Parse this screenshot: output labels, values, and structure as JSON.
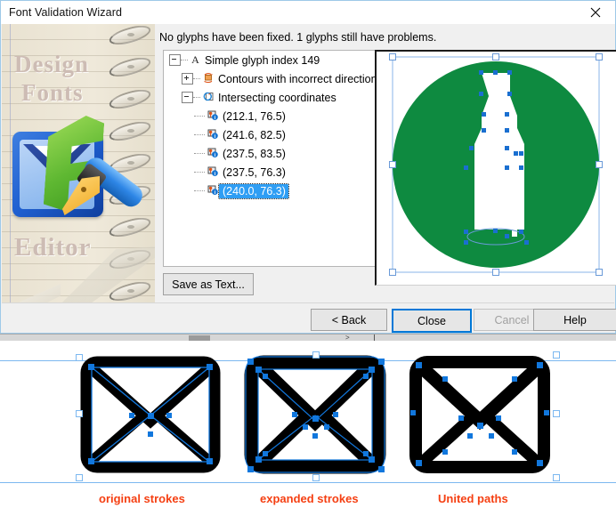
{
  "window": {
    "title": "Font Validation Wizard",
    "close_icon": "close-icon"
  },
  "status": {
    "message": "No glyphs have been fixed. 1 glyphs still have problems."
  },
  "banner": {
    "word_top": "Design",
    "word_mid": "Fonts",
    "word_bottom": "Editor"
  },
  "tree": {
    "root": {
      "label": "Simple glyph index 149",
      "icon": "glyph-a-icon",
      "expander": "minus"
    },
    "nodes": [
      {
        "label": "Contours with incorrect direction",
        "icon": "contour-direction-icon",
        "expander": "plus"
      },
      {
        "label": "Intersecting coordinates",
        "icon": "intersecting-coordinates-icon",
        "expander": "minus"
      }
    ],
    "coordinates": [
      {
        "label": "(212.1, 76.5)",
        "selected": false
      },
      {
        "label": "(241.6, 82.5)",
        "selected": false
      },
      {
        "label": "(237.5, 83.5)",
        "selected": false
      },
      {
        "label": "(237.5, 76.3)",
        "selected": false
      },
      {
        "label": "(240.0, 76.3)",
        "selected": true
      }
    ]
  },
  "actions": {
    "save_as_text": "Save as Text...",
    "back": "< Back",
    "close": "Close",
    "cancel": "Cancel",
    "help": "Help"
  },
  "preview": {
    "shape": "bottle-in-circle-glyph",
    "fill_color": "#0e8a40",
    "anchor_color": "#1a6fd0",
    "handle_color": "#8ab6ea"
  },
  "illustration": {
    "captions": [
      "original strokes",
      "expanded strokes",
      "United paths"
    ],
    "caption_color": "#f53f12",
    "envelope_color": "#000000",
    "anchor_color": "#1177dd",
    "items": [
      {
        "name": "envelope-original-strokes"
      },
      {
        "name": "envelope-expanded-strokes"
      },
      {
        "name": "envelope-united-paths"
      }
    ]
  }
}
